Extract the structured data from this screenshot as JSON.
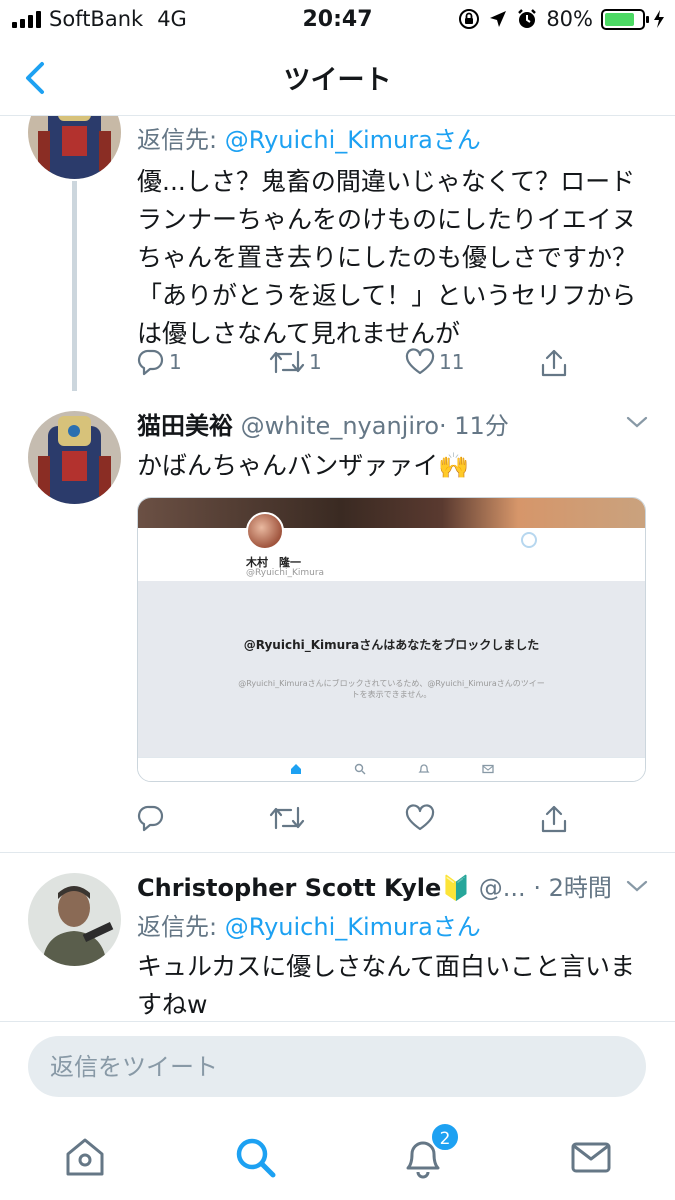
{
  "status_bar": {
    "carrier": "SoftBank",
    "network": "4G",
    "time": "20:47",
    "battery": "80%",
    "battery_level": 0.8
  },
  "nav": {
    "title": "ツイート",
    "back_icon": "chevron-left-icon"
  },
  "tweets": [
    {
      "reply_to_label": "返信先: ",
      "reply_to_mention": "@Ryuichi_Kimuraさん",
      "text": "優...しさ？鬼畜の間違いじゃなくて？ロードランナーちゃんをのけものにしたりイエイヌちゃんを置き去りにしたのも優しさですか？「ありがとうを返して！」というセリフからは優しさなんて見れませんが",
      "replies": "1",
      "retweets": "1",
      "likes": "11"
    },
    {
      "name": "猫田美裕",
      "handle": "@white_nyanjiro",
      "time": "· 11分",
      "text": "かばんちゃんバンザァァイ🙌",
      "card": {
        "name": "木村　隆一",
        "handle": "@Ryuichi_Kimura",
        "message": "@Ryuichi_Kimuraさんはあなたをブロックしました",
        "sub": "@Ryuichi_Kimuraさんにブロックされているため、@Ryuichi_Kimuraさんのツイートを表示できません。"
      }
    },
    {
      "name": "Christopher Scott Kyle🔰",
      "handle": "@...",
      "time": "· 2時間",
      "reply_to_label": "返信先: ",
      "reply_to_mention": "@Ryuichi_Kimuraさん",
      "text": "キュルカスに優しさなんて面白いこと言いますねw"
    }
  ],
  "reply_bar": {
    "placeholder": "返信をツイート"
  },
  "tab_bar": {
    "items": [
      "home-icon",
      "search-icon",
      "notifications-icon",
      "messages-icon"
    ],
    "notification_badge": "2"
  },
  "colors": {
    "accent": "#1da1f2",
    "muted": "#657786",
    "divider": "#e1e8ed"
  }
}
